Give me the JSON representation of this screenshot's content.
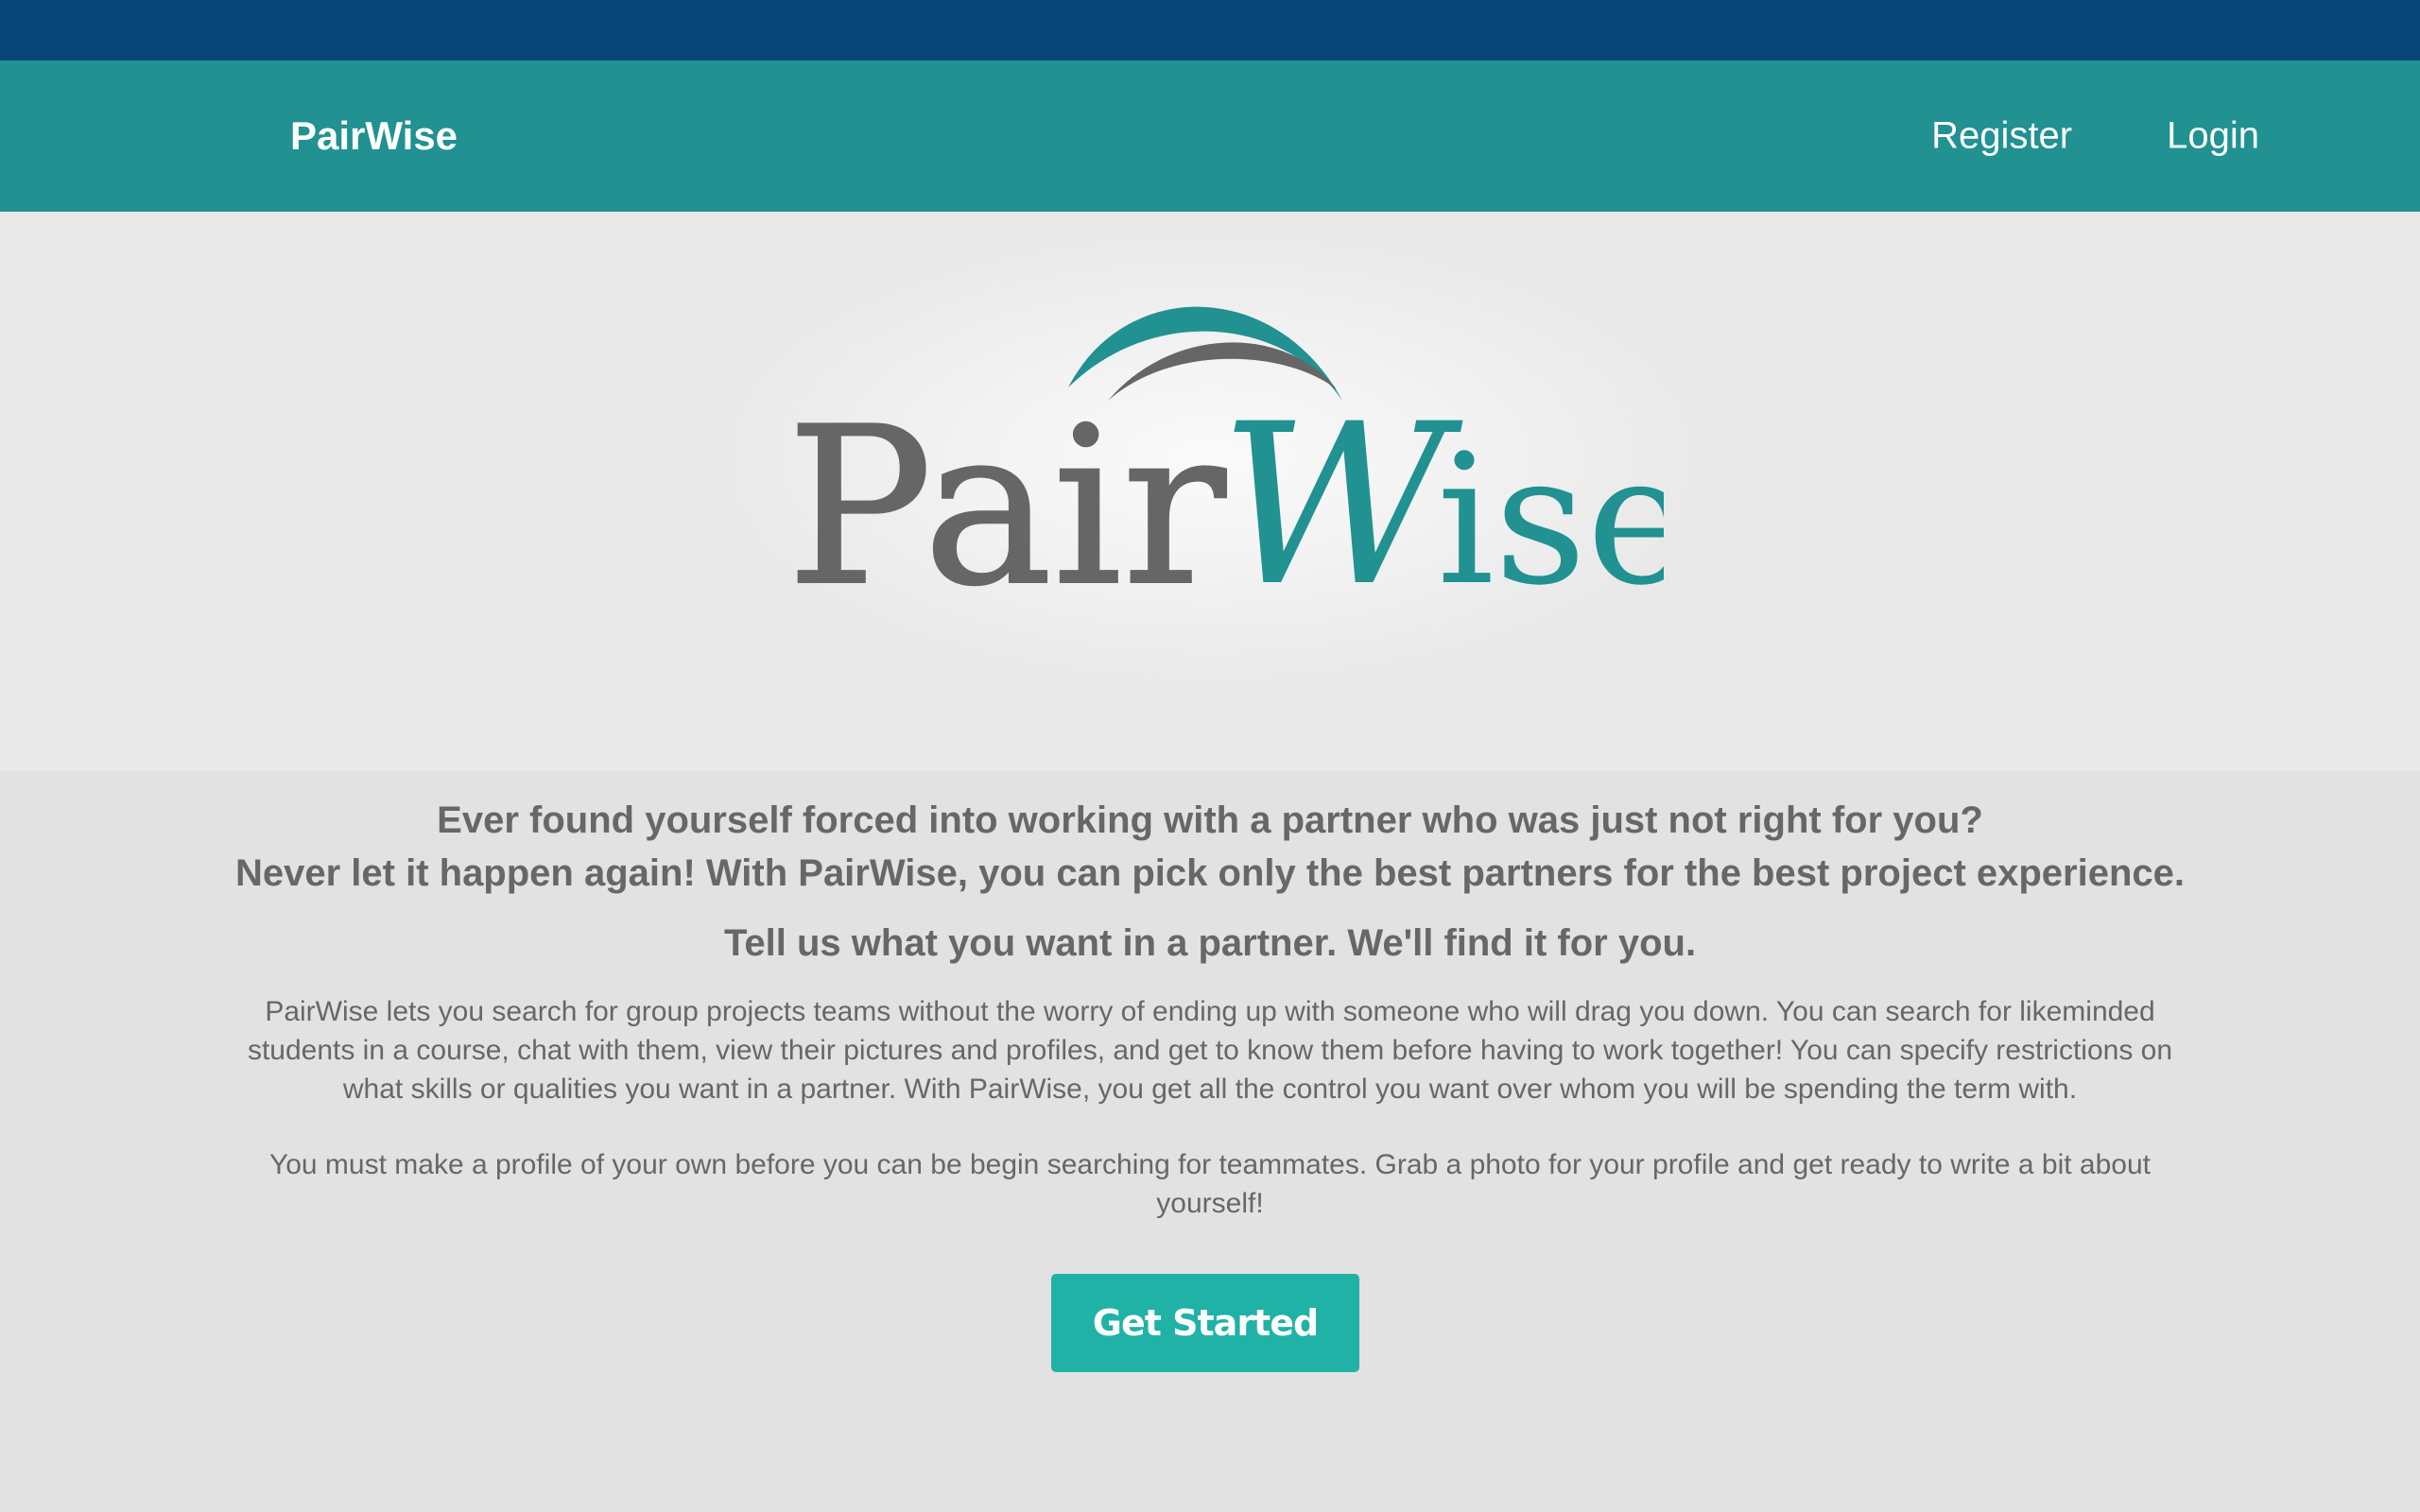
{
  "colors": {
    "top_strip": "#074579",
    "navbar": "#219192",
    "accent_teal": "#20b2a6",
    "logo_gray": "#666666",
    "logo_teal": "#219192",
    "text": "#676767"
  },
  "navbar": {
    "brand": "PairWise",
    "links": [
      {
        "label": "Register"
      },
      {
        "label": "Login"
      }
    ]
  },
  "hero": {
    "logo_text_left": "Pair",
    "logo_text_w": "W",
    "logo_text_right": "ise"
  },
  "main": {
    "headline_line1": "Ever found yourself forced into working with a partner who was just not right for you?",
    "headline_line2": "Never let it happen again! With PairWise, you can pick only the best partners for the best project experience.",
    "subheadline": "Tell us what you want in a partner. We'll find it for you.",
    "paragraph1": "PairWise lets you search for group projects teams without the worry of ending up with someone who will drag you down. You can search for likeminded students in a course, chat with them, view their pictures and profiles, and get to know them before having to work together! You can specify restrictions on what skills or qualities you want in a partner. With PairWise, you get all the control you want over whom you will be spending the term with.",
    "paragraph2": "You must make a profile of your own before you can be begin searching for teammates. Grab a photo for your profile and get ready to write a bit about yourself!",
    "cta_label": "Get Started"
  }
}
